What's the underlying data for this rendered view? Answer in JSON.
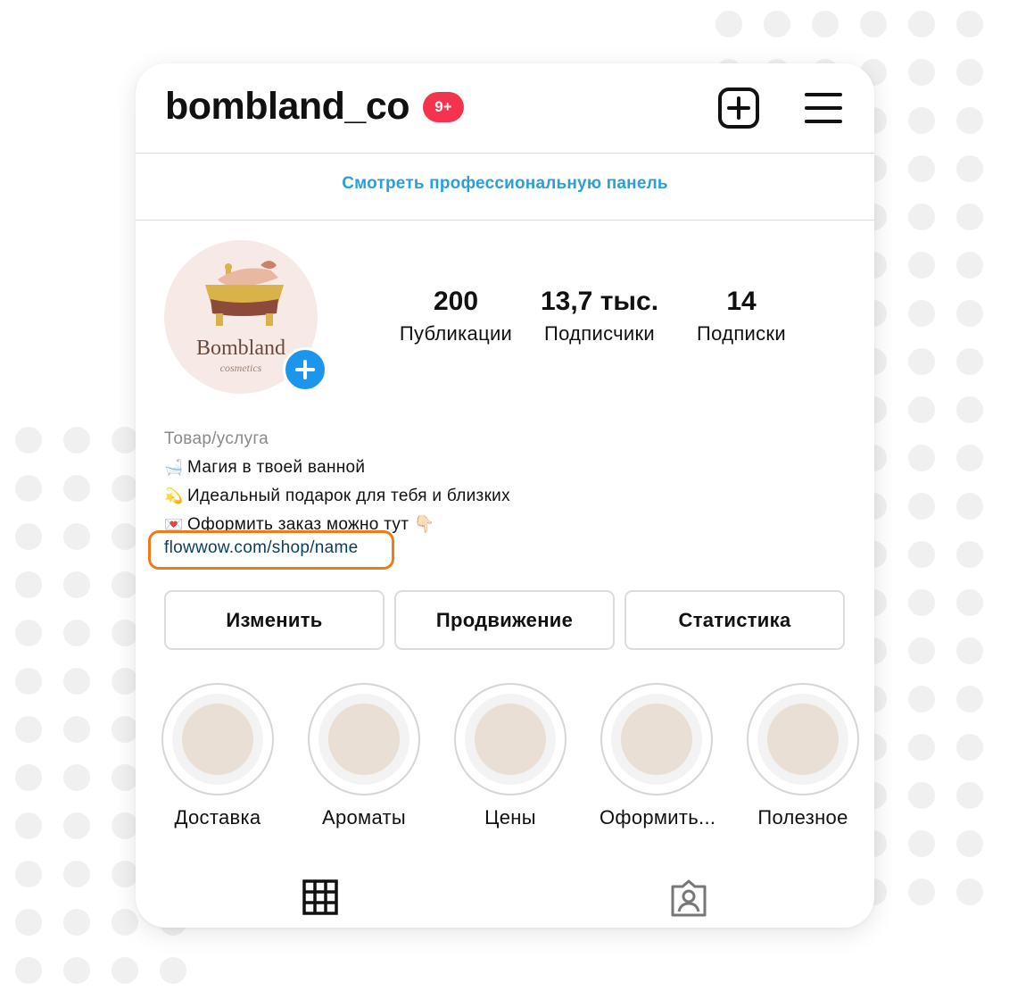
{
  "header": {
    "username": "bombland_co",
    "notifications_badge": "9+",
    "new_post_icon": "plus-square-icon",
    "menu_icon": "hamburger-menu-icon"
  },
  "pro_panel": {
    "label": "Смотреть профессиональную панель"
  },
  "profile": {
    "avatar": {
      "brand_text": "Bombland",
      "brand_subtext": "cosmetics"
    },
    "stats": [
      {
        "value": "200",
        "label": "Публикации"
      },
      {
        "value": "13,7 тыс.",
        "label": "Подписчики"
      },
      {
        "value": "14",
        "label": "Подписки"
      }
    ]
  },
  "bio": {
    "category": "Товар/услуга",
    "lines": [
      {
        "emoji": "🛁",
        "text": "Магия в твоей ванной"
      },
      {
        "emoji": "💫",
        "text": "Идеальный подарок для тебя и близких"
      },
      {
        "emoji": "💌",
        "text": "Оформить заказ можно тут 👇🏻"
      }
    ],
    "link": "flowwow.com/shop/name"
  },
  "actions": {
    "edit": "Изменить",
    "promote": "Продвижение",
    "insights": "Статистика"
  },
  "highlights": [
    {
      "label": "Доставка"
    },
    {
      "label": "Ароматы"
    },
    {
      "label": "Цены"
    },
    {
      "label": "Оформить..."
    },
    {
      "label": "Полезное"
    }
  ],
  "tabs": {
    "grid_icon": "grid-icon",
    "tagged_icon": "tagged-person-icon"
  },
  "colors": {
    "link_blue": "#2b9fd8",
    "badge_red": "#f4344f",
    "add_story_blue": "#1c96ed",
    "link_highlight_orange": "#f07a1a",
    "highlight_core": "#e9dfd4"
  }
}
